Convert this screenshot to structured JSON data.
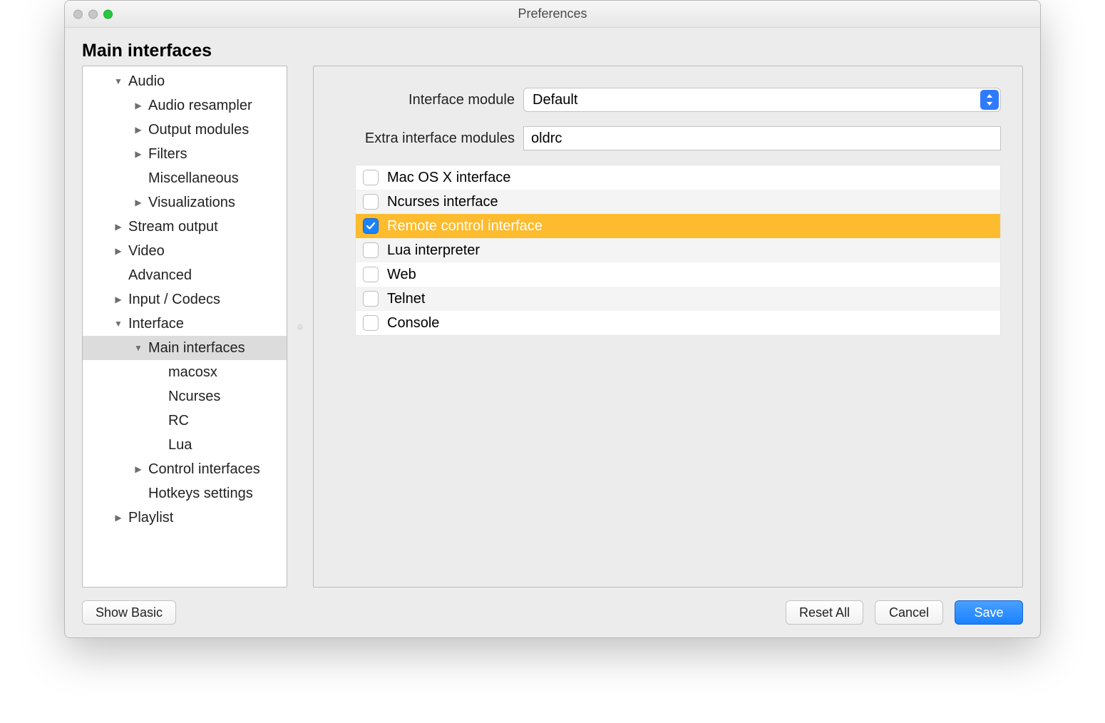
{
  "window": {
    "title": "Preferences"
  },
  "panel_title": "Main interfaces",
  "tree": [
    {
      "label": "Audio",
      "level": 0,
      "disclosure": "open"
    },
    {
      "label": "Audio resampler",
      "level": 1,
      "disclosure": "closed"
    },
    {
      "label": "Output modules",
      "level": 1,
      "disclosure": "closed"
    },
    {
      "label": "Filters",
      "level": 1,
      "disclosure": "closed"
    },
    {
      "label": "Miscellaneous",
      "level": 1,
      "disclosure": "none"
    },
    {
      "label": "Visualizations",
      "level": 1,
      "disclosure": "closed"
    },
    {
      "label": "Stream output",
      "level": 0,
      "disclosure": "closed"
    },
    {
      "label": "Video",
      "level": 0,
      "disclosure": "closed"
    },
    {
      "label": "Advanced",
      "level": 0,
      "disclosure": "none"
    },
    {
      "label": "Input / Codecs",
      "level": 0,
      "disclosure": "closed"
    },
    {
      "label": "Interface",
      "level": 0,
      "disclosure": "open"
    },
    {
      "label": "Main interfaces",
      "level": 1,
      "disclosure": "open",
      "selected": true
    },
    {
      "label": "macosx",
      "level": 2,
      "disclosure": "none"
    },
    {
      "label": "Ncurses",
      "level": 2,
      "disclosure": "none"
    },
    {
      "label": "RC",
      "level": 2,
      "disclosure": "none"
    },
    {
      "label": "Lua",
      "level": 2,
      "disclosure": "none"
    },
    {
      "label": "Control interfaces",
      "level": 1,
      "disclosure": "closed"
    },
    {
      "label": "Hotkeys settings",
      "level": 1,
      "disclosure": "none"
    },
    {
      "label": "Playlist",
      "level": 0,
      "disclosure": "closed"
    }
  ],
  "form": {
    "interface_module_label": "Interface module",
    "interface_module_value": "Default",
    "extra_modules_label": "Extra interface modules",
    "extra_modules_value": "oldrc"
  },
  "modules_list": [
    {
      "label": "Mac OS X interface",
      "checked": false
    },
    {
      "label": "Ncurses interface",
      "checked": false
    },
    {
      "label": "Remote control interface",
      "checked": true,
      "selected": true
    },
    {
      "label": "Lua interpreter",
      "checked": false
    },
    {
      "label": "Web",
      "checked": false
    },
    {
      "label": "Telnet",
      "checked": false
    },
    {
      "label": "Console",
      "checked": false
    }
  ],
  "footer": {
    "show_basic": "Show Basic",
    "reset_all": "Reset All",
    "cancel": "Cancel",
    "save": "Save"
  }
}
